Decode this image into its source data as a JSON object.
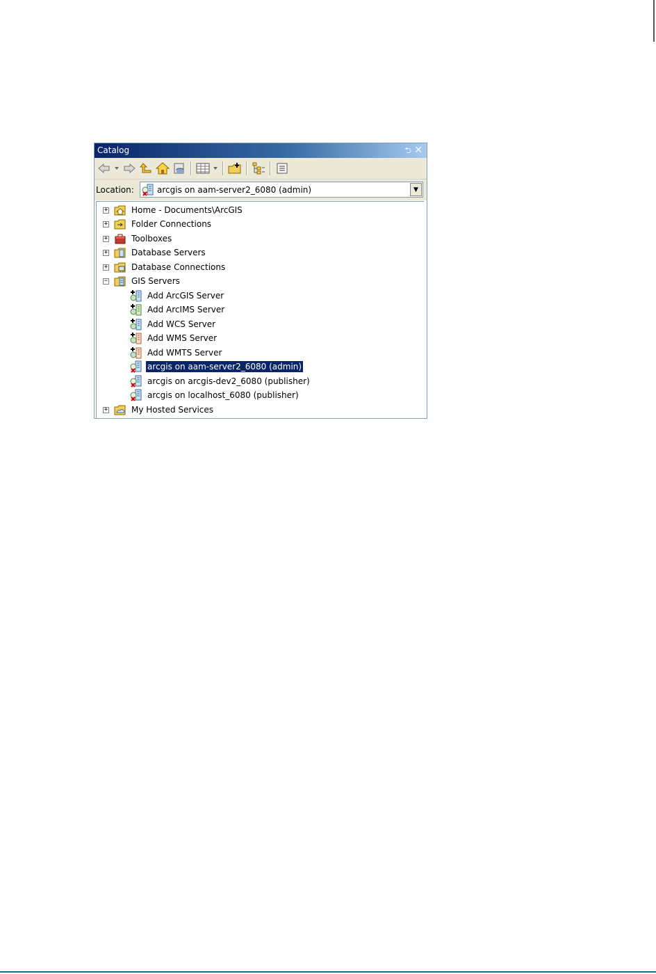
{
  "window": {
    "title": "Catalog"
  },
  "toolbar": {
    "buttons": [
      {
        "name": "back-icon"
      },
      {
        "name": "back-dropdown-icon"
      },
      {
        "name": "forward-icon"
      },
      {
        "name": "up-one-level-icon"
      },
      {
        "name": "home-icon"
      },
      {
        "name": "default-geodatabase-icon"
      },
      {
        "name": "views-icon"
      },
      {
        "name": "views-dropdown-icon"
      },
      {
        "name": "connect-to-folder-icon"
      },
      {
        "name": "toggle-contents-panel-icon"
      },
      {
        "name": "options-icon"
      }
    ]
  },
  "location": {
    "label": "Location:",
    "value": "arcgis on aam-server2_6080 (admin)"
  },
  "tree": {
    "items": [
      {
        "label": "Home - Documents\\ArcGIS",
        "icon": "home-folder-icon",
        "expander": "+"
      },
      {
        "label": "Folder Connections",
        "icon": "folder-connection-icon",
        "expander": "+"
      },
      {
        "label": "Toolboxes",
        "icon": "toolbox-icon",
        "expander": "+"
      },
      {
        "label": "Database Servers",
        "icon": "database-server-icon",
        "expander": "+"
      },
      {
        "label": "Database Connections",
        "icon": "database-connection-icon",
        "expander": "+"
      },
      {
        "label": "GIS Servers",
        "icon": "gis-server-icon",
        "expander": "−"
      },
      {
        "label": "Add ArcGIS Server",
        "icon": "add-server-icon"
      },
      {
        "label": "Add ArcIMS Server",
        "icon": "add-server-icon"
      },
      {
        "label": "Add WCS Server",
        "icon": "add-server-icon"
      },
      {
        "label": "Add WMS Server",
        "icon": "add-server-icon"
      },
      {
        "label": "Add WMTS Server",
        "icon": "add-server-icon"
      },
      {
        "label": "arcgis on aam-server2_6080 (admin)",
        "icon": "server-disconnected-icon",
        "selected": true
      },
      {
        "label": "arcgis on arcgis-dev2_6080 (publisher)",
        "icon": "server-disconnected-icon"
      },
      {
        "label": "arcgis on localhost_6080 (publisher)",
        "icon": "server-disconnected-icon"
      },
      {
        "label": "My Hosted Services",
        "icon": "hosted-services-icon",
        "expander": "+"
      }
    ]
  },
  "colors": {
    "title_gradient_start": "#0a246a",
    "selection": "#0a246a",
    "toolbar_bg": "#ece9d8"
  }
}
